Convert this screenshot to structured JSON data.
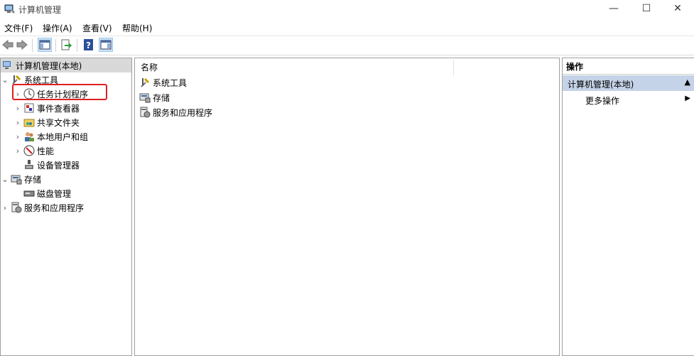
{
  "window": {
    "title": "计算机管理",
    "minimize": "—",
    "maximize": "☐",
    "close": "✕"
  },
  "menu": [
    "文件(F)",
    "操作(A)",
    "查看(V)",
    "帮助(H)"
  ],
  "toolbar": [
    "back-icon",
    "forward-icon",
    "show-hide-tree-icon",
    "export-list-icon",
    "help-icon",
    "show-hide-action-pane-icon"
  ],
  "tree": {
    "root": "计算机管理(本地)",
    "system_tools": "系统工具",
    "task_scheduler": "任务计划程序",
    "event_viewer": "事件查看器",
    "shared_folders": "共享文件夹",
    "local_users": "本地用户和组",
    "performance": "性能",
    "device_manager": "设备管理器",
    "storage": "存储",
    "disk_management": "磁盘管理",
    "services_apps": "服务和应用程序"
  },
  "list": {
    "column_name": "名称",
    "items": [
      "系统工具",
      "存储",
      "服务和应用程序"
    ]
  },
  "actions": {
    "header": "操作",
    "section": "计算机管理(本地)",
    "more": "更多操作"
  },
  "colors": {
    "highlight": "#e02020",
    "section_bg": "#c5d3e8"
  }
}
